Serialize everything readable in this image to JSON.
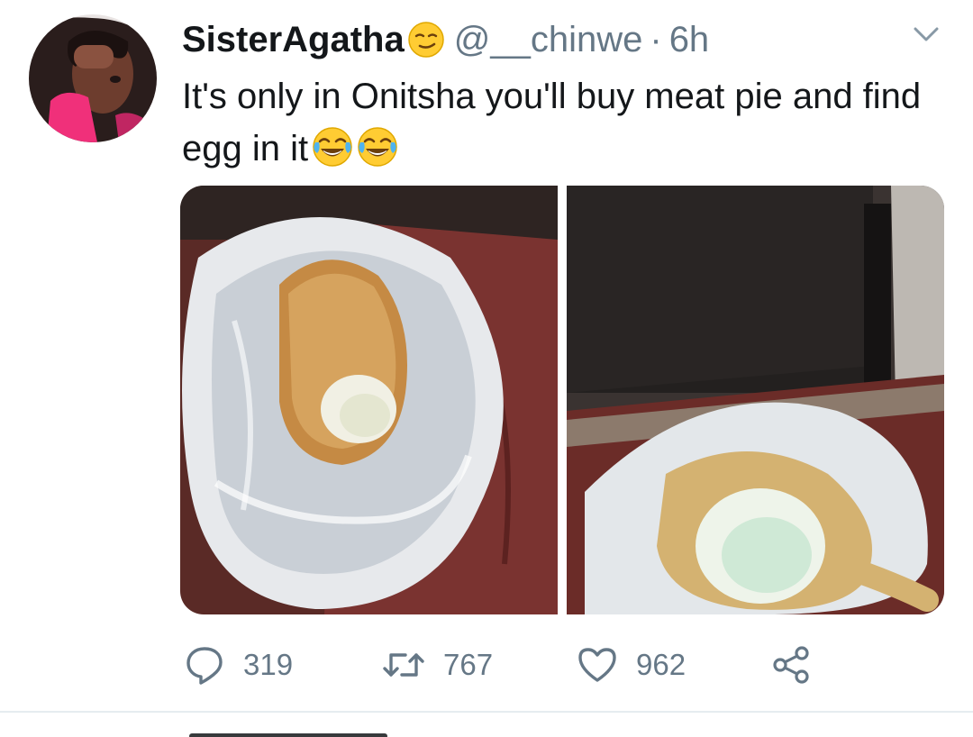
{
  "tweet": {
    "display_name": "SisterAgatha",
    "name_emoji": "smirking-face-emoji",
    "handle": "@__chinwe",
    "separator": "·",
    "time": "6h",
    "text": "It's only in Onitsha you'll buy meat pie and find egg in it",
    "text_emojis": [
      "face-with-tears-of-joy-emoji",
      "face-with-tears-of-joy-emoji"
    ],
    "media": [
      {
        "name": "photo-meat-pie-in-bag"
      },
      {
        "name": "photo-egg-inside-pie"
      }
    ]
  },
  "actions": {
    "reply": {
      "icon": "reply-icon",
      "count": "319"
    },
    "retweet": {
      "icon": "retweet-icon",
      "count": "767"
    },
    "like": {
      "icon": "heart-icon",
      "count": "962"
    },
    "share": {
      "icon": "share-icon"
    }
  },
  "colors": {
    "primary_text": "#14171a",
    "secondary_text": "#657786",
    "divider": "#e6ecf0",
    "emoji_yellow": "#ffcc33"
  }
}
